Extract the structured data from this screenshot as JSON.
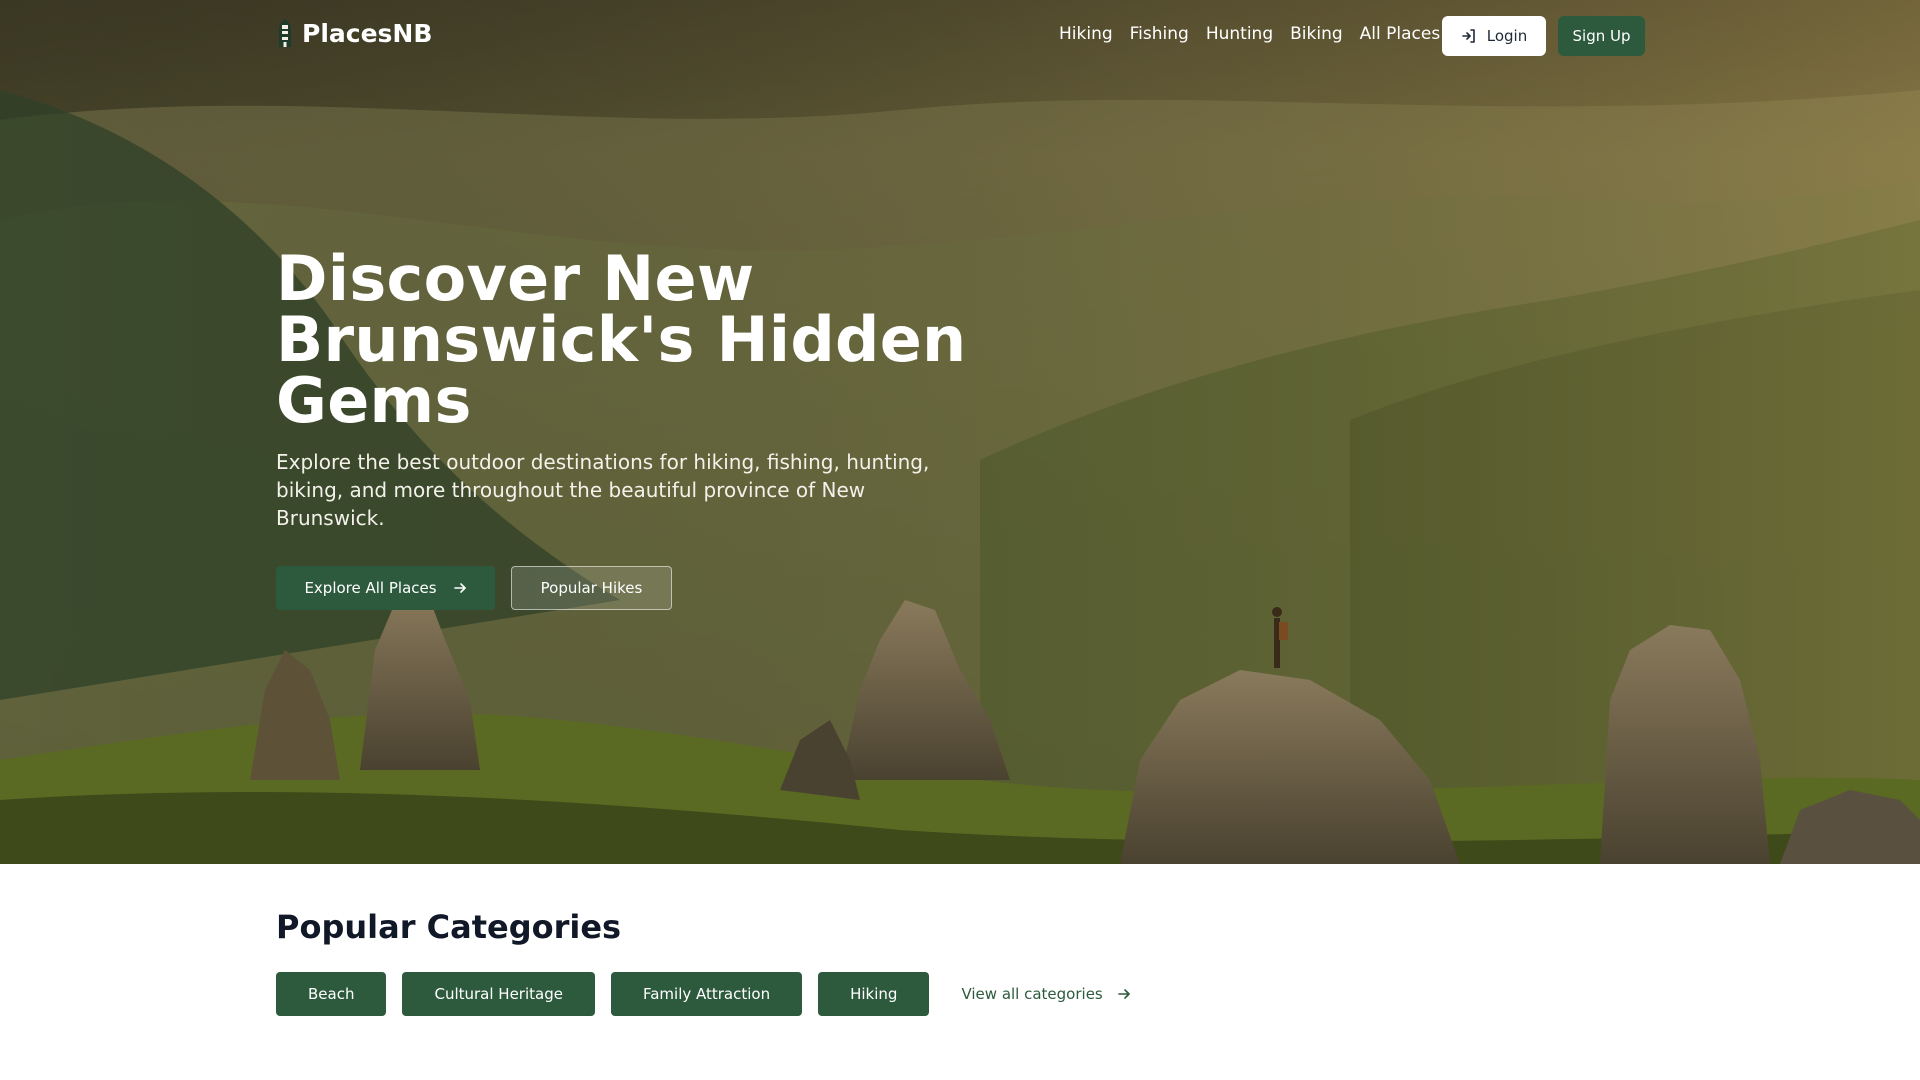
{
  "nav": {
    "brand": "PlacesNB",
    "brand_icon": "lighthouse-icon",
    "links": [
      "Hiking",
      "Fishing",
      "Hunting",
      "Biking",
      "All Places"
    ],
    "login_label": "Login",
    "login_icon": "sign-in-icon",
    "signup_label": "Sign Up"
  },
  "hero": {
    "title": "Discover New Brunswick's Hidden Gems",
    "subtitle": "Explore the best outdoor destinations for hiking, fishing, hunting, biking, and more throughout the beautiful province of New Brunswick.",
    "primary_button": "Explore All Places",
    "primary_icon": "arrow-right-icon",
    "secondary_button": "Popular Hikes"
  },
  "categories": {
    "title": "Popular Categories",
    "items": [
      "Beach",
      "Cultural Heritage",
      "Family Attraction",
      "Hiking"
    ],
    "view_all": "View all categories",
    "view_all_icon": "arrow-right-icon"
  },
  "colors": {
    "brand_green": "#2d5a3d",
    "white": "#ffffff",
    "heading": "#111827"
  }
}
